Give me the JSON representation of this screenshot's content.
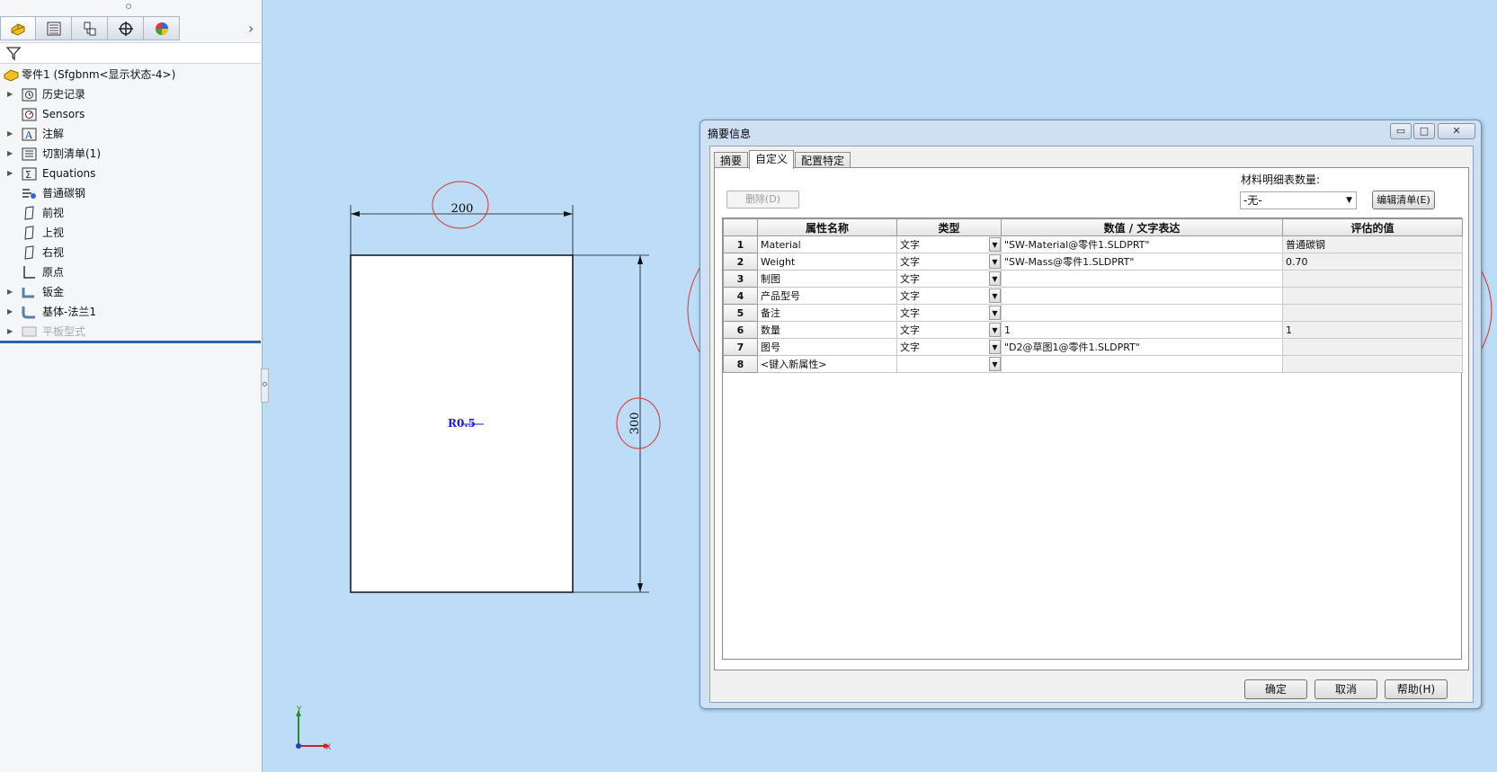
{
  "feature_manager": {
    "tabs": [
      "feature-manager-tab-icon",
      "property-manager-tab-icon",
      "configuration-manager-tab-icon",
      "dimxpert-manager-tab-icon",
      "display-manager-tab-icon"
    ],
    "tree": [
      {
        "label": "零件1  (Sfgbnm<显示状态-4>)",
        "icon": "part-icon",
        "expandable": false,
        "root": true
      },
      {
        "label": "历史记录",
        "icon": "history-folder-icon",
        "expandable": true
      },
      {
        "label": "Sensors",
        "icon": "sensors-icon",
        "expandable": false
      },
      {
        "label": "注解",
        "icon": "annotations-icon",
        "expandable": true
      },
      {
        "label": "切割清单(1)",
        "icon": "cut-list-icon",
        "expandable": true
      },
      {
        "label": "Equations",
        "icon": "equations-icon",
        "expandable": true
      },
      {
        "label": "普通碳钢",
        "icon": "material-icon",
        "expandable": false
      },
      {
        "label": "前视",
        "icon": "plane-icon",
        "expandable": false
      },
      {
        "label": "上视",
        "icon": "plane-icon",
        "expandable": false
      },
      {
        "label": "右视",
        "icon": "plane-icon",
        "expandable": false
      },
      {
        "label": "原点",
        "icon": "origin-icon",
        "expandable": false
      },
      {
        "label": "钣金",
        "icon": "sheet-metal-icon",
        "expandable": true
      },
      {
        "label": "基体-法兰1",
        "icon": "base-flange-icon",
        "expandable": true
      },
      {
        "label": "平板型式",
        "icon": "flat-pattern-icon",
        "expandable": true,
        "disabled": true
      }
    ]
  },
  "drawing": {
    "width_dim": "200",
    "height_dim": "300",
    "radius_note": "R0.5",
    "axis_y": "Y",
    "axis_x": "X"
  },
  "dialog": {
    "title": "摘要信息",
    "tabs": [
      "摘要",
      "自定义",
      "配置特定"
    ],
    "active_tab": "自定义",
    "delete_button": "删除(D)",
    "bom_label": "材料明细表数量:",
    "bom_value": "-无-",
    "edit_list_button": "编辑清单(E)",
    "columns": [
      "",
      "属性名称",
      "类型",
      "数值 / 文字表达",
      "评估的值"
    ],
    "rows": [
      {
        "num": "1",
        "name": "Material",
        "type": "文字",
        "value": "\"SW-Material@零件1.SLDPRT\"",
        "evaluated": "普通碳钢"
      },
      {
        "num": "2",
        "name": "Weight",
        "type": "文字",
        "value": "\"SW-Mass@零件1.SLDPRT\"",
        "evaluated": "0.70"
      },
      {
        "num": "3",
        "name": "制图",
        "type": "文字",
        "value": "",
        "evaluated": ""
      },
      {
        "num": "4",
        "name": "产品型号",
        "type": "文字",
        "value": "",
        "evaluated": ""
      },
      {
        "num": "5",
        "name": "备注",
        "type": "文字",
        "value": "",
        "evaluated": ""
      },
      {
        "num": "6",
        "name": "数量",
        "type": "文字",
        "value": "1",
        "evaluated": "1"
      },
      {
        "num": "7",
        "name": "图号",
        "type": "文字",
        "value": "\"D2@草图1@零件1.SLDPRT\"",
        "evaluated": ""
      },
      {
        "num": "8",
        "name": "<键入新属性>",
        "type": "",
        "value": "",
        "evaluated": ""
      }
    ],
    "ok_button": "确定",
    "cancel_button": "取消",
    "help_button": "帮助(H)"
  },
  "colors": {
    "graphics_background": "#bcdcf7",
    "annotation_circle": "#e03030",
    "radius_text": "#1a1ae6"
  }
}
